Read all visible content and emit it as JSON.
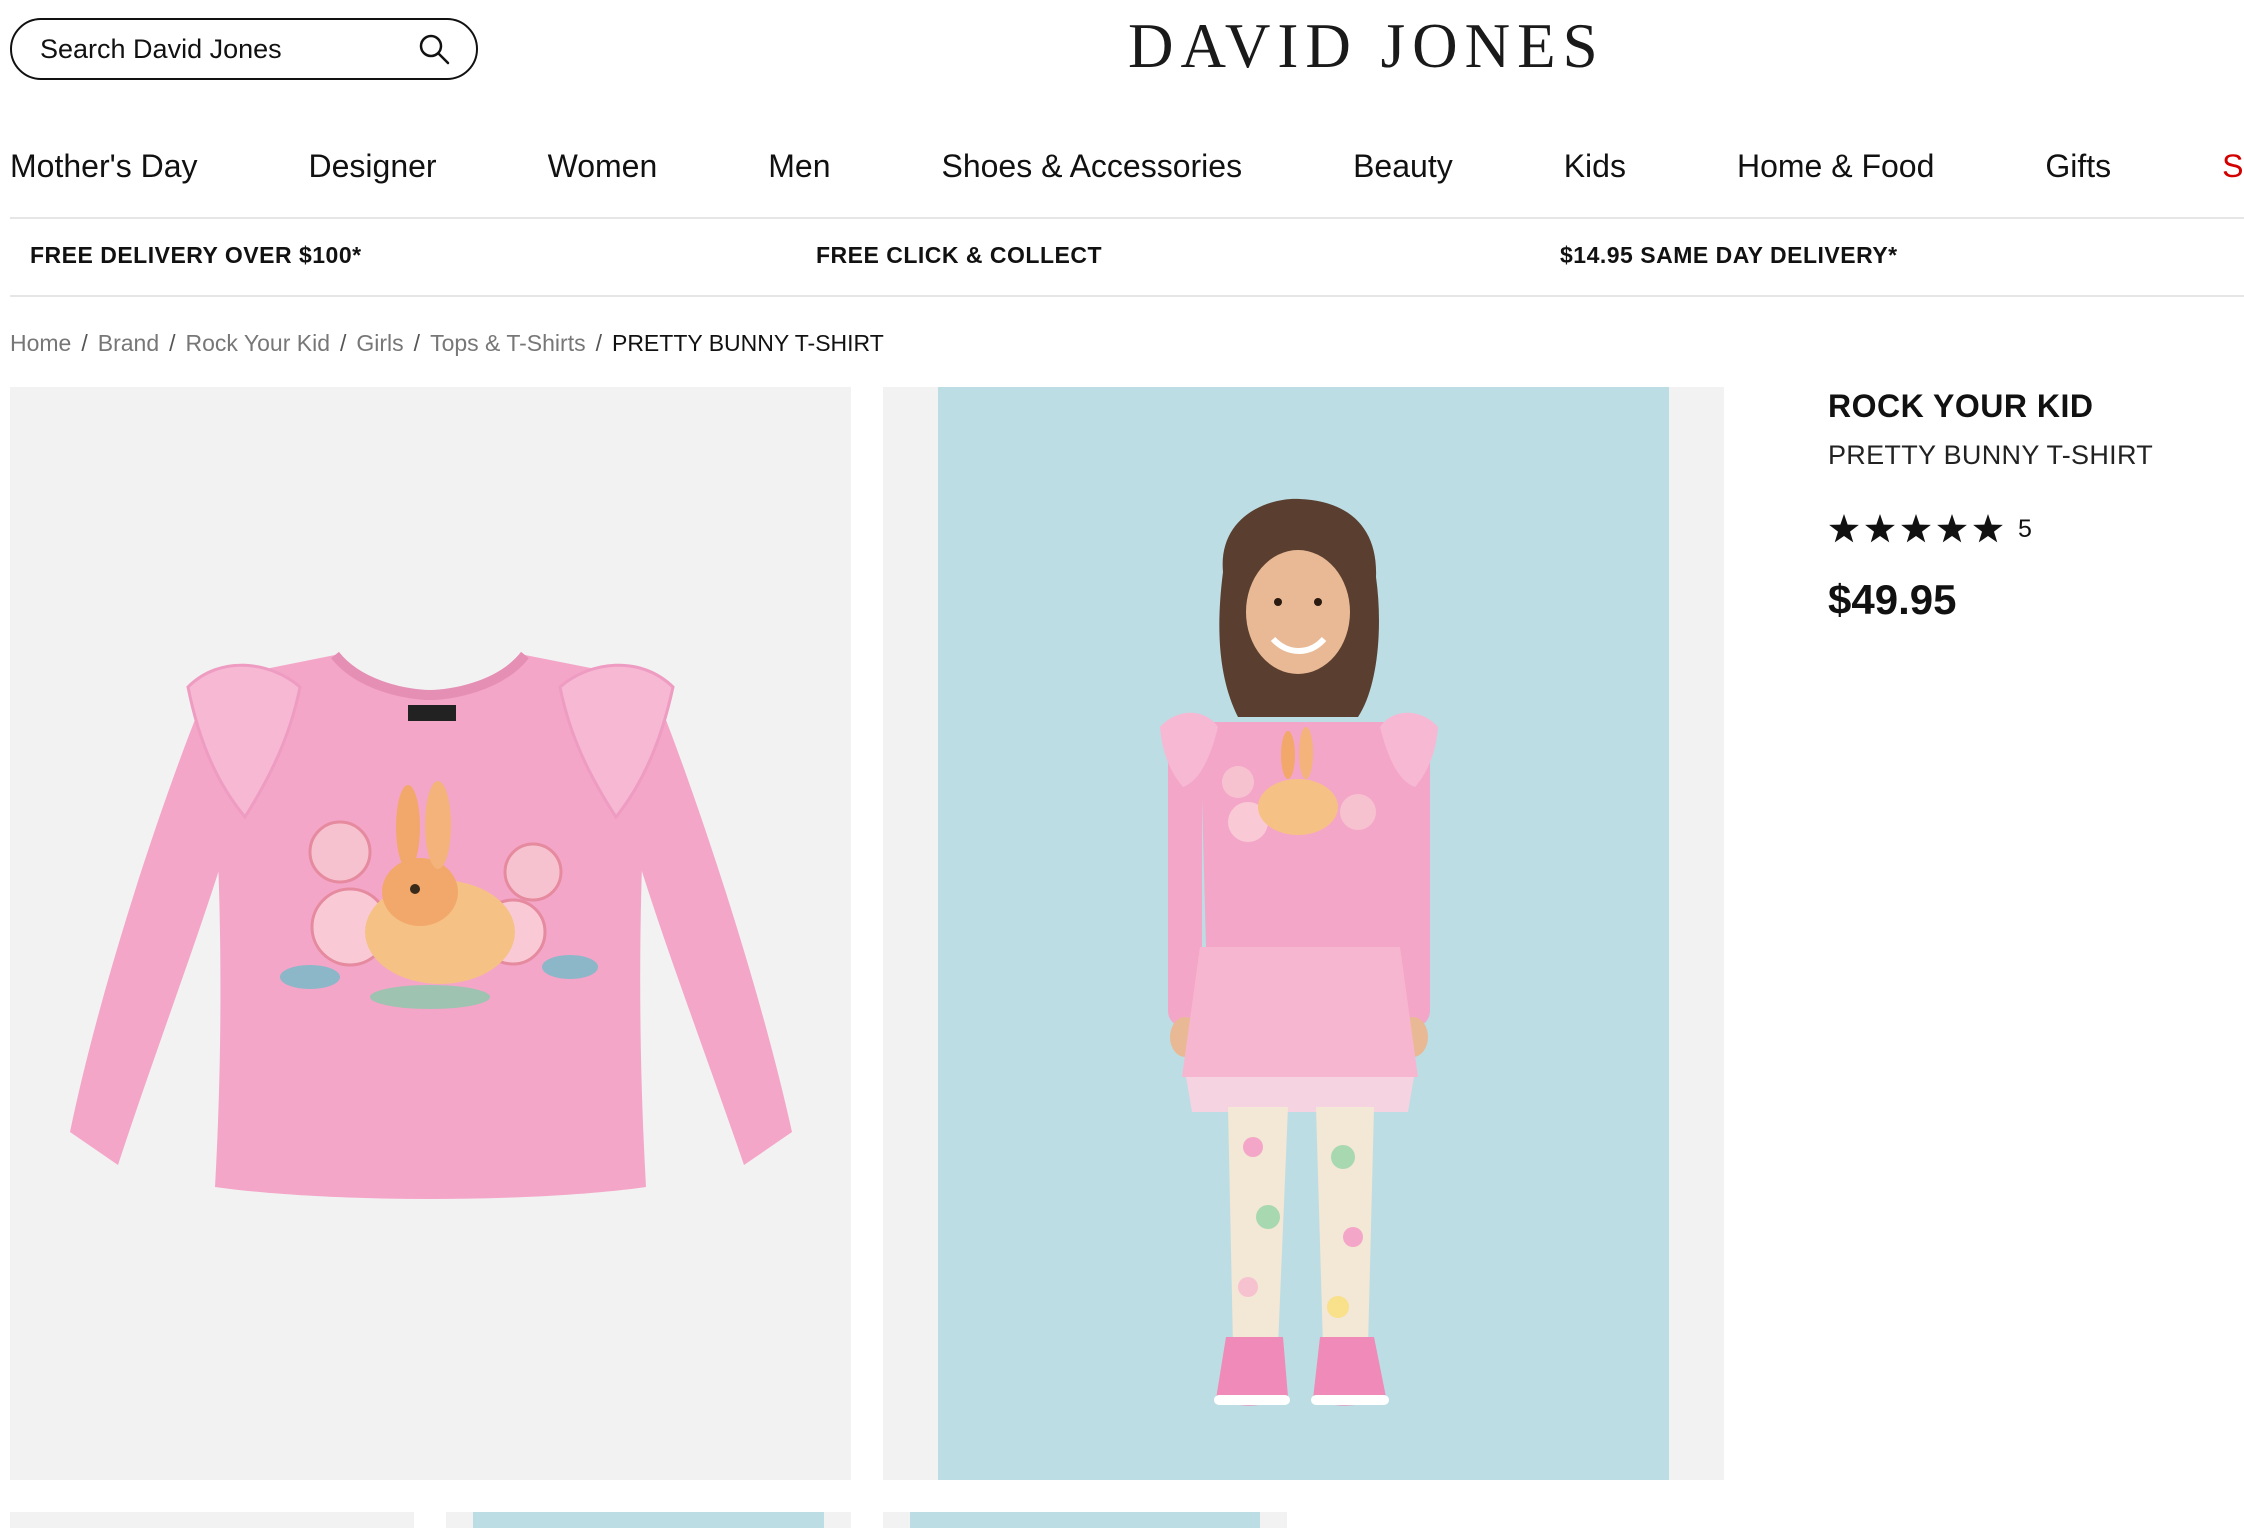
{
  "header": {
    "search_placeholder": "Search David Jones",
    "logo": "DAVID JONES"
  },
  "nav": [
    {
      "label": "Mother's Day"
    },
    {
      "label": "Designer"
    },
    {
      "label": "Women"
    },
    {
      "label": "Men"
    },
    {
      "label": "Shoes & Accessories"
    },
    {
      "label": "Beauty"
    },
    {
      "label": "Kids"
    },
    {
      "label": "Home & Food"
    },
    {
      "label": "Gifts"
    },
    {
      "label": "Sal"
    }
  ],
  "promos": [
    "FREE DELIVERY OVER $100*",
    "FREE CLICK & COLLECT",
    "$14.95 SAME DAY DELIVERY*"
  ],
  "breadcrumb": {
    "links": [
      "Home",
      "Brand",
      "Rock Your Kid",
      "Girls",
      "Tops & T-Shirts"
    ],
    "current": "PRETTY BUNNY T-SHIRT"
  },
  "product": {
    "brand": "ROCK YOUR KID",
    "name": "PRETTY BUNNY T-SHIRT",
    "rating": 5,
    "review_count": "5",
    "price": "$49.95"
  },
  "icons": {
    "search": "search-icon",
    "star": "star-icon"
  },
  "colors": {
    "sale": "#d40000",
    "shirt_pink": "#f4a6c8",
    "photo_backdrop": "#bcdde3"
  }
}
